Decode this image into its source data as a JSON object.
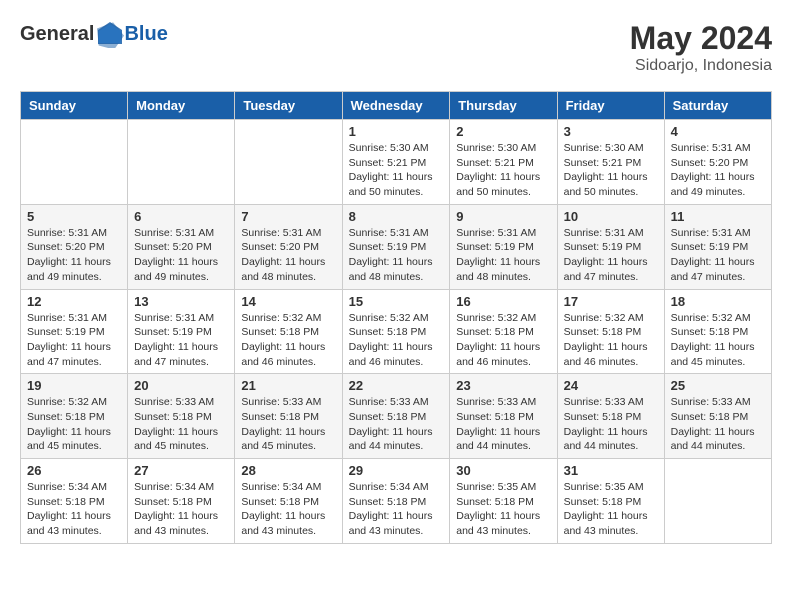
{
  "header": {
    "logo_general": "General",
    "logo_blue": "Blue",
    "month_year": "May 2024",
    "location": "Sidoarjo, Indonesia"
  },
  "weekdays": [
    "Sunday",
    "Monday",
    "Tuesday",
    "Wednesday",
    "Thursday",
    "Friday",
    "Saturday"
  ],
  "weeks": [
    [
      {
        "day": "",
        "info": ""
      },
      {
        "day": "",
        "info": ""
      },
      {
        "day": "",
        "info": ""
      },
      {
        "day": "1",
        "info": "Sunrise: 5:30 AM\nSunset: 5:21 PM\nDaylight: 11 hours\nand 50 minutes."
      },
      {
        "day": "2",
        "info": "Sunrise: 5:30 AM\nSunset: 5:21 PM\nDaylight: 11 hours\nand 50 minutes."
      },
      {
        "day": "3",
        "info": "Sunrise: 5:30 AM\nSunset: 5:21 PM\nDaylight: 11 hours\nand 50 minutes."
      },
      {
        "day": "4",
        "info": "Sunrise: 5:31 AM\nSunset: 5:20 PM\nDaylight: 11 hours\nand 49 minutes."
      }
    ],
    [
      {
        "day": "5",
        "info": "Sunrise: 5:31 AM\nSunset: 5:20 PM\nDaylight: 11 hours\nand 49 minutes."
      },
      {
        "day": "6",
        "info": "Sunrise: 5:31 AM\nSunset: 5:20 PM\nDaylight: 11 hours\nand 49 minutes."
      },
      {
        "day": "7",
        "info": "Sunrise: 5:31 AM\nSunset: 5:20 PM\nDaylight: 11 hours\nand 48 minutes."
      },
      {
        "day": "8",
        "info": "Sunrise: 5:31 AM\nSunset: 5:19 PM\nDaylight: 11 hours\nand 48 minutes."
      },
      {
        "day": "9",
        "info": "Sunrise: 5:31 AM\nSunset: 5:19 PM\nDaylight: 11 hours\nand 48 minutes."
      },
      {
        "day": "10",
        "info": "Sunrise: 5:31 AM\nSunset: 5:19 PM\nDaylight: 11 hours\nand 47 minutes."
      },
      {
        "day": "11",
        "info": "Sunrise: 5:31 AM\nSunset: 5:19 PM\nDaylight: 11 hours\nand 47 minutes."
      }
    ],
    [
      {
        "day": "12",
        "info": "Sunrise: 5:31 AM\nSunset: 5:19 PM\nDaylight: 11 hours\nand 47 minutes."
      },
      {
        "day": "13",
        "info": "Sunrise: 5:31 AM\nSunset: 5:19 PM\nDaylight: 11 hours\nand 47 minutes."
      },
      {
        "day": "14",
        "info": "Sunrise: 5:32 AM\nSunset: 5:18 PM\nDaylight: 11 hours\nand 46 minutes."
      },
      {
        "day": "15",
        "info": "Sunrise: 5:32 AM\nSunset: 5:18 PM\nDaylight: 11 hours\nand 46 minutes."
      },
      {
        "day": "16",
        "info": "Sunrise: 5:32 AM\nSunset: 5:18 PM\nDaylight: 11 hours\nand 46 minutes."
      },
      {
        "day": "17",
        "info": "Sunrise: 5:32 AM\nSunset: 5:18 PM\nDaylight: 11 hours\nand 46 minutes."
      },
      {
        "day": "18",
        "info": "Sunrise: 5:32 AM\nSunset: 5:18 PM\nDaylight: 11 hours\nand 45 minutes."
      }
    ],
    [
      {
        "day": "19",
        "info": "Sunrise: 5:32 AM\nSunset: 5:18 PM\nDaylight: 11 hours\nand 45 minutes."
      },
      {
        "day": "20",
        "info": "Sunrise: 5:33 AM\nSunset: 5:18 PM\nDaylight: 11 hours\nand 45 minutes."
      },
      {
        "day": "21",
        "info": "Sunrise: 5:33 AM\nSunset: 5:18 PM\nDaylight: 11 hours\nand 45 minutes."
      },
      {
        "day": "22",
        "info": "Sunrise: 5:33 AM\nSunset: 5:18 PM\nDaylight: 11 hours\nand 44 minutes."
      },
      {
        "day": "23",
        "info": "Sunrise: 5:33 AM\nSunset: 5:18 PM\nDaylight: 11 hours\nand 44 minutes."
      },
      {
        "day": "24",
        "info": "Sunrise: 5:33 AM\nSunset: 5:18 PM\nDaylight: 11 hours\nand 44 minutes."
      },
      {
        "day": "25",
        "info": "Sunrise: 5:33 AM\nSunset: 5:18 PM\nDaylight: 11 hours\nand 44 minutes."
      }
    ],
    [
      {
        "day": "26",
        "info": "Sunrise: 5:34 AM\nSunset: 5:18 PM\nDaylight: 11 hours\nand 43 minutes."
      },
      {
        "day": "27",
        "info": "Sunrise: 5:34 AM\nSunset: 5:18 PM\nDaylight: 11 hours\nand 43 minutes."
      },
      {
        "day": "28",
        "info": "Sunrise: 5:34 AM\nSunset: 5:18 PM\nDaylight: 11 hours\nand 43 minutes."
      },
      {
        "day": "29",
        "info": "Sunrise: 5:34 AM\nSunset: 5:18 PM\nDaylight: 11 hours\nand 43 minutes."
      },
      {
        "day": "30",
        "info": "Sunrise: 5:35 AM\nSunset: 5:18 PM\nDaylight: 11 hours\nand 43 minutes."
      },
      {
        "day": "31",
        "info": "Sunrise: 5:35 AM\nSunset: 5:18 PM\nDaylight: 11 hours\nand 43 minutes."
      },
      {
        "day": "",
        "info": ""
      }
    ]
  ]
}
